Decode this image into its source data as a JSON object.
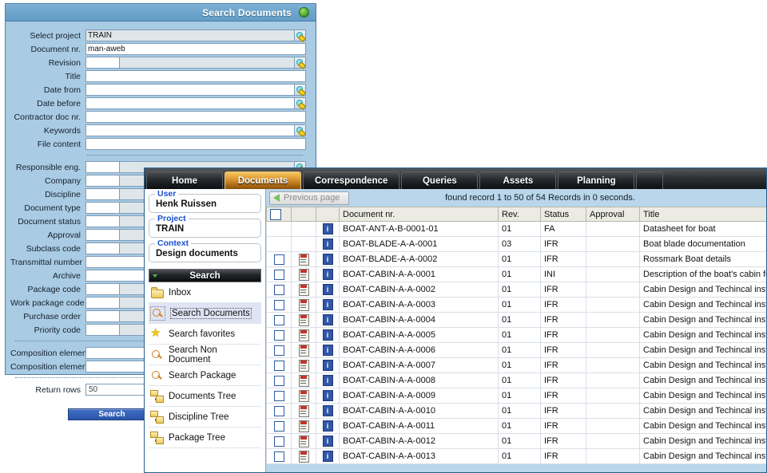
{
  "search_window": {
    "title": "Search Documents",
    "globe_icon": "globe-icon",
    "fields": [
      {
        "label": "Select project",
        "type": "lookup-grey",
        "value": "TRAIN"
      },
      {
        "label": "Document nr.",
        "type": "text",
        "value": "man-aweb"
      },
      {
        "label": "Revision",
        "type": "split-lookup",
        "value": ""
      },
      {
        "label": "Title",
        "type": "text",
        "value": ""
      },
      {
        "label": "Date from",
        "type": "lookup",
        "value": ""
      },
      {
        "label": "Date before",
        "type": "lookup",
        "value": ""
      },
      {
        "label": "Contractor doc nr.",
        "type": "text",
        "value": ""
      },
      {
        "label": "Keywords",
        "type": "lookup",
        "value": ""
      },
      {
        "label": "File content",
        "type": "text",
        "value": ""
      }
    ],
    "fields2": [
      {
        "label": "Responsible eng.",
        "type": "split-lookup",
        "value": ""
      },
      {
        "label": "Company",
        "type": "split-lookup",
        "value": ""
      },
      {
        "label": "Discipline",
        "type": "split",
        "value": ""
      },
      {
        "label": "Document type",
        "type": "split",
        "value": ""
      },
      {
        "label": "Document status",
        "type": "split",
        "value": ""
      },
      {
        "label": "Approval",
        "type": "split",
        "value": ""
      },
      {
        "label": "Subclass code",
        "type": "split",
        "value": ""
      },
      {
        "label": "Transmittal number",
        "type": "text",
        "value": ""
      },
      {
        "label": "Archive",
        "type": "text",
        "value": ""
      },
      {
        "label": "Package code",
        "type": "split",
        "value": ""
      },
      {
        "label": "Work package code",
        "type": "split",
        "value": ""
      },
      {
        "label": "Purchase order",
        "type": "split",
        "value": ""
      },
      {
        "label": "Priority code",
        "type": "split",
        "value": ""
      }
    ],
    "fields3": [
      {
        "label": "Composition element",
        "type": "lookup",
        "value": ""
      },
      {
        "label": "Composition element",
        "type": "lookup",
        "value": ""
      }
    ],
    "return_rows": {
      "label": "Return rows",
      "value": "50"
    },
    "buttons": [
      {
        "label": "Search",
        "name": "search-button"
      },
      {
        "label": "",
        "name": "secondary-button"
      }
    ]
  },
  "app_window": {
    "tabs": [
      {
        "label": "Home",
        "active": false
      },
      {
        "label": "Documents",
        "active": true
      },
      {
        "label": "Correspondence",
        "active": false
      },
      {
        "label": "Queries",
        "active": false
      },
      {
        "label": "Assets",
        "active": false
      },
      {
        "label": "Planning",
        "active": false
      },
      {
        "label": "",
        "active": false
      }
    ],
    "sidebar": {
      "info_boxes": [
        {
          "legend": "User",
          "value": "Henk Ruissen"
        },
        {
          "legend": "Project",
          "value": "TRAIN"
        },
        {
          "legend": "Context",
          "value": "Design documents"
        }
      ],
      "section_header": "Search",
      "items": [
        {
          "label": "Inbox",
          "icon": "folder-icon",
          "selected": false
        },
        {
          "label": "Search Documents",
          "icon": "magnifier-icon",
          "selected": true
        },
        {
          "label": "Search favorites",
          "icon": "star-icon",
          "selected": false
        },
        {
          "label": "Search Non Document",
          "icon": "magnifier-icon",
          "selected": false
        },
        {
          "label": "Search Package",
          "icon": "magnifier-icon",
          "selected": false
        },
        {
          "label": "Documents Tree",
          "icon": "tree-icon",
          "selected": false
        },
        {
          "label": "Discipline Tree",
          "icon": "tree-icon",
          "selected": false
        },
        {
          "label": "Package Tree",
          "icon": "tree-icon",
          "selected": false
        }
      ]
    },
    "toolbar": {
      "previous_page_label": "Previous page",
      "found_text": "found record 1 to 50 of 54 Records in 0 seconds."
    },
    "table": {
      "columns": [
        "",
        "",
        "",
        "Document nr.",
        "Rev.",
        "Status",
        "Approval",
        "Title"
      ],
      "rows": [
        {
          "chk": false,
          "pdf": false,
          "info": true,
          "doc": "BOAT-ANT-A-B-0001-01",
          "rev": "01",
          "status": "FA",
          "approval": "",
          "title": "Datasheet for boat"
        },
        {
          "chk": false,
          "pdf": false,
          "info": true,
          "doc": "BOAT-BLADE-A-A-0001",
          "rev": "03",
          "status": "IFR",
          "approval": "",
          "title": "Boat blade documentation"
        },
        {
          "chk": true,
          "pdf": true,
          "info": true,
          "doc": "BOAT-BLADE-A-A-0002",
          "rev": "01",
          "status": "IFR",
          "approval": "",
          "title": "Rossmark Boat details"
        },
        {
          "chk": true,
          "pdf": true,
          "info": true,
          "doc": "BOAT-CABIN-A-A-0001",
          "rev": "01",
          "status": "INI",
          "approval": "",
          "title": "Description of the boat's cabin form Hnek's"
        },
        {
          "chk": true,
          "pdf": true,
          "info": true,
          "doc": "BOAT-CABIN-A-A-0002",
          "rev": "01",
          "status": "IFR",
          "approval": "",
          "title": "Cabin Design and Techincal installations pa"
        },
        {
          "chk": true,
          "pdf": true,
          "info": true,
          "doc": "BOAT-CABIN-A-A-0003",
          "rev": "01",
          "status": "IFR",
          "approval": "",
          "title": "Cabin Design and Techincal installations pa"
        },
        {
          "chk": true,
          "pdf": true,
          "info": true,
          "doc": "BOAT-CABIN-A-A-0004",
          "rev": "01",
          "status": "IFR",
          "approval": "",
          "title": "Cabin Design and Techincal installations pa"
        },
        {
          "chk": true,
          "pdf": true,
          "info": true,
          "doc": "BOAT-CABIN-A-A-0005",
          "rev": "01",
          "status": "IFR",
          "approval": "",
          "title": "Cabin Design and Techincal installations pa"
        },
        {
          "chk": true,
          "pdf": true,
          "info": true,
          "doc": "BOAT-CABIN-A-A-0006",
          "rev": "01",
          "status": "IFR",
          "approval": "",
          "title": "Cabin Design and Techincal installations pa"
        },
        {
          "chk": true,
          "pdf": true,
          "info": true,
          "doc": "BOAT-CABIN-A-A-0007",
          "rev": "01",
          "status": "IFR",
          "approval": "",
          "title": "Cabin Design and Techincal installations pa"
        },
        {
          "chk": true,
          "pdf": true,
          "info": true,
          "doc": "BOAT-CABIN-A-A-0008",
          "rev": "01",
          "status": "IFR",
          "approval": "",
          "title": "Cabin Design and Techincal installations pa"
        },
        {
          "chk": true,
          "pdf": true,
          "info": true,
          "doc": "BOAT-CABIN-A-A-0009",
          "rev": "01",
          "status": "IFR",
          "approval": "",
          "title": "Cabin Design and Techincal installations pa"
        },
        {
          "chk": true,
          "pdf": true,
          "info": true,
          "doc": "BOAT-CABIN-A-A-0010",
          "rev": "01",
          "status": "IFR",
          "approval": "",
          "title": "Cabin Design and Techincal installations pa"
        },
        {
          "chk": true,
          "pdf": true,
          "info": true,
          "doc": "BOAT-CABIN-A-A-0011",
          "rev": "01",
          "status": "IFR",
          "approval": "",
          "title": "Cabin Design and Techincal installations pa"
        },
        {
          "chk": true,
          "pdf": true,
          "info": true,
          "doc": "BOAT-CABIN-A-A-0012",
          "rev": "01",
          "status": "IFR",
          "approval": "",
          "title": "Cabin Design and Techincal installations pa"
        },
        {
          "chk": true,
          "pdf": true,
          "info": true,
          "doc": "BOAT-CABIN-A-A-0013",
          "rev": "01",
          "status": "IFR",
          "approval": "",
          "title": "Cabin Design and Techincal installations pa"
        }
      ]
    }
  },
  "colors": {
    "window_title_blue": "#6ea5cc",
    "window_body_blue": "#a9cbe4",
    "active_tab_orange": "#d8922c",
    "button_blue": "#2b56aa",
    "legend_blue": "#1b4fd0"
  }
}
